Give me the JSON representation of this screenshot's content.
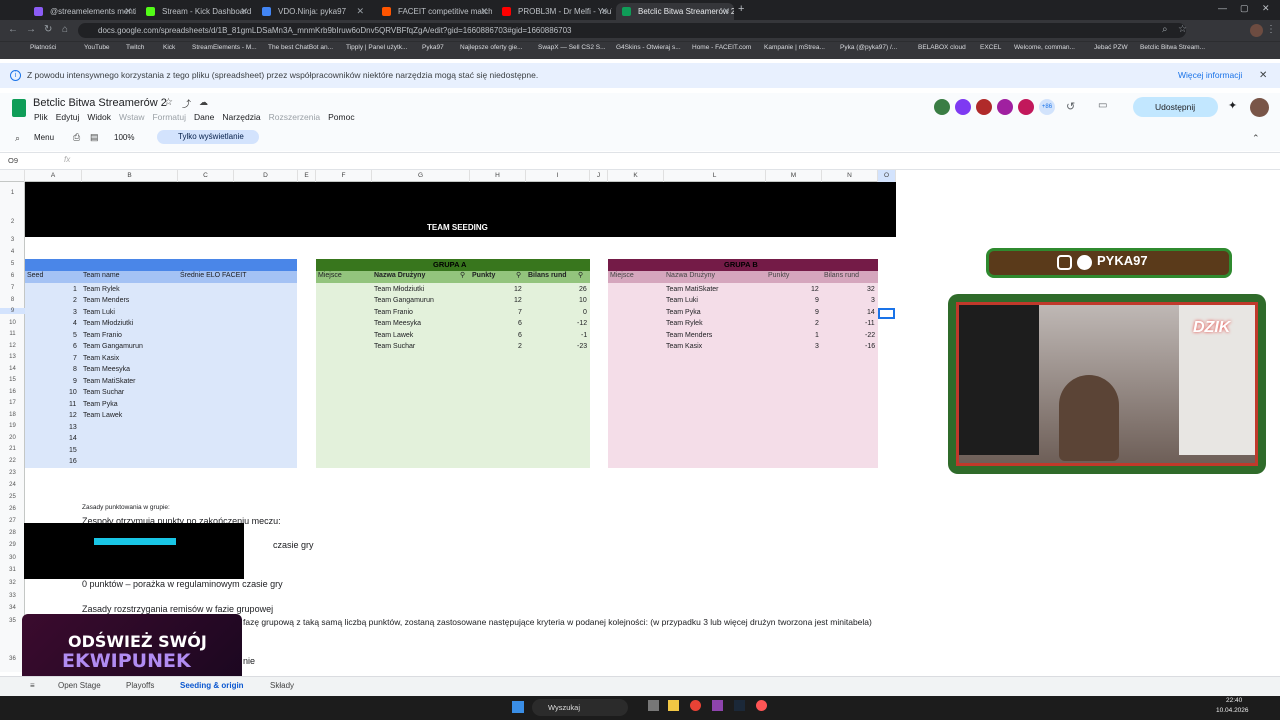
{
  "browser": {
    "tabs": [
      {
        "label": "@streamelements mention",
        "color": "#8b5cf6"
      },
      {
        "label": "Stream - Kick Dashboard",
        "color": "#53fc18"
      },
      {
        "label": "VDO.Ninja: pyka97",
        "color": "#4285f4"
      },
      {
        "label": "FACEIT competitive match - Fifi",
        "color": "#ff5500"
      },
      {
        "label": "PROBL3M - Dr Melfi - YouT",
        "color": "#ff0000"
      },
      {
        "label": "Betclic Bitwa Streamerów 2 - A",
        "color": "#0f9d58"
      }
    ],
    "url": "docs.google.com/spreadsheets/d/1B_81gmLDSaMn3A_mnmKrb9bIruw6oDnv5QRVBFfqZgA/edit?gid=1660886703#gid=1660886703",
    "bookmarks": [
      "Płatności",
      "YouTube",
      "Twitch",
      "Kick",
      "StreamElements - M...",
      "The best ChatBot an...",
      "Tipply | Panel użytk...",
      "Pyka97",
      "Najlepsze oferty gie...",
      "SwapX — Sell CS2 S...",
      "G4Skins - Otwieraj s...",
      "Home - FACEIT.com",
      "Kampanie | mStrea...",
      "Pyka (@pyka97) /...",
      "BELABOX cloud",
      "EXCEL",
      "Welcome, comman...",
      "Jebać PZW",
      "Betclic Bitwa Stream..."
    ]
  },
  "banner": {
    "text": "Z powodu intensywnego korzystania z tego pliku (spreadsheet) przez współpracowników niektóre narzędzia mogą stać się niedostępne.",
    "link": "Więcej informacji"
  },
  "doc": {
    "title": "Betclic Bitwa Streamerów 2",
    "menu": [
      "Plik",
      "Edytuj",
      "Widok",
      "Wstaw",
      "Formatuj",
      "Dane",
      "Narzędzia",
      "Rozszerzenia",
      "Pomoc"
    ],
    "toolbar": {
      "menu": "Menu",
      "zoom": "100%",
      "view_only": "Tylko wyświetlanie"
    },
    "share": "Udostępnij",
    "avatars_more": "+86",
    "cell_ref": "O9"
  },
  "columns": [
    "A",
    "B",
    "C",
    "D",
    "E",
    "F",
    "G",
    "H",
    "I",
    "J",
    "K",
    "L",
    "M",
    "N",
    "O"
  ],
  "rows": [
    "1",
    "2",
    "3",
    "4",
    "5",
    "6",
    "7",
    "8",
    "9",
    "10",
    "11",
    "12",
    "13",
    "14",
    "15",
    "16",
    "17",
    "18",
    "19",
    "20",
    "21",
    "22",
    "23",
    "24",
    "25",
    "26",
    "27",
    "28",
    "29",
    "30",
    "31",
    "32",
    "33",
    "34",
    "35",
    "36"
  ],
  "sheet": {
    "title": "TEAM SEEDING",
    "seeding": {
      "headers": [
        "Seed",
        "Team name",
        "Średnie ELO FACEIT"
      ],
      "rows": [
        [
          "1",
          "Team Rylek"
        ],
        [
          "2",
          "Team Menders"
        ],
        [
          "3",
          "Team Luki"
        ],
        [
          "4",
          "Team Młodziutki"
        ],
        [
          "5",
          "Team Franio"
        ],
        [
          "6",
          "Team Gangamurun"
        ],
        [
          "7",
          "Team Kasix"
        ],
        [
          "8",
          "Team Meesyka"
        ],
        [
          "9",
          "Team MatiSkater"
        ],
        [
          "10",
          "Team Suchar"
        ],
        [
          "11",
          "Team Pyka"
        ],
        [
          "12",
          "Team Lawek"
        ],
        [
          "13",
          ""
        ],
        [
          "14",
          ""
        ],
        [
          "15",
          ""
        ],
        [
          "16",
          ""
        ]
      ]
    },
    "group_a": {
      "title": "GRUPA A",
      "headers": [
        "Miejsce",
        "Nazwa Drużyny",
        "Punkty",
        "Bilans rund"
      ],
      "rows": [
        [
          "Team Młodziutki",
          "12",
          "26"
        ],
        [
          "Team Gangamurun",
          "12",
          "10"
        ],
        [
          "Team Franio",
          "7",
          "0"
        ],
        [
          "Team Meesyka",
          "6",
          "-12"
        ],
        [
          "Team Lawek",
          "6",
          "-1"
        ],
        [
          "Team Suchar",
          "2",
          "-23"
        ]
      ]
    },
    "group_b": {
      "title": "GRUPA B",
      "headers": [
        "Miejsce",
        "Nazwa Drużyny",
        "Punkty",
        "Bilans rund"
      ],
      "rows": [
        [
          "Team MatiSkater",
          "12",
          "32"
        ],
        [
          "Team Luki",
          "9",
          "3"
        ],
        [
          "Team Pyka",
          "9",
          "14"
        ],
        [
          "Team Rylek",
          "2",
          "-11"
        ],
        [
          "Team Menders",
          "1",
          "-22"
        ],
        [
          "Team Kasix",
          "3",
          "-16"
        ]
      ]
    },
    "rules": {
      "r26": "Zasady punktowania w grupie:",
      "r27": "Zespoły otrzymują punkty po zakończeniu meczu:",
      "r29": "czasie gry",
      "r32": "0 punktów – porażka w regulaminowym czasie gry",
      "r34": "Zasady rozstrzygania remisów w fazie grupowej",
      "r35": "fazę grupową z taką samą liczbą punktów, zostaną zastosowane następujące kryteria w podanej kolejności: (w przypadku 3 lub więcej drużyn tworzona jest minitabela)",
      "r36": "nie"
    }
  },
  "overlay": {
    "social": "PYKA97",
    "promo_line1": "ODŚWIEŻ SWÓJ",
    "promo_line2": "EKWIPUNEK",
    "logo": "DZIK"
  },
  "sheet_tabs": [
    "Open Stage",
    "Playoffs",
    "Seeding & origin",
    "Składy"
  ],
  "taskbar": {
    "search": "Wyszukaj",
    "time": "22:40",
    "date": "10.04.2026"
  }
}
